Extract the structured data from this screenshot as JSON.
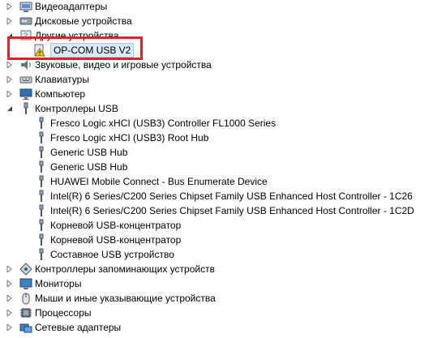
{
  "categories_top": [
    {
      "label": "Видеоадаптеры",
      "icon": "display-adapter-icon",
      "expanded": false
    },
    {
      "label": "Дисковые устройства",
      "icon": "disk-drive-icon",
      "expanded": false
    },
    {
      "label": "Другие устройства",
      "icon": "other-devices-icon",
      "expanded": true
    }
  ],
  "other_device": {
    "label": "OP-COM USB V2",
    "icon": "warning-device-icon"
  },
  "categories_mid": [
    {
      "label": "Звуковые, видео и игровые устройства",
      "icon": "sound-icon",
      "expanded": false
    },
    {
      "label": "Клавиатуры",
      "icon": "keyboard-icon",
      "expanded": false
    },
    {
      "label": "Компьютер",
      "icon": "computer-icon",
      "expanded": false
    },
    {
      "label": "Контроллеры USB",
      "icon": "usb-controller-icon",
      "expanded": true
    }
  ],
  "usb_children": [
    "Fresco Logic xHCI (USB3) Controller FL1000 Series",
    "Fresco Logic xHCI (USB3) Root Hub",
    "Generic USB Hub",
    "Generic USB Hub",
    "HUAWEI Mobile Connect - Bus Enumerate Device",
    "Intel(R) 6 Series/C200 Series Chipset Family USB Enhanced Host Controller - 1C26",
    "Intel(R) 6 Series/C200 Series Chipset Family USB Enhanced Host Controller - 1C2D",
    "Корневой USB-концентратор",
    "Корневой USB-концентратор",
    "Составное USB устройство"
  ],
  "categories_bottom": [
    {
      "label": "Контроллеры запоминающих устройств",
      "icon": "storage-controller-icon",
      "expanded": false
    },
    {
      "label": "Мониторы",
      "icon": "monitor-icon",
      "expanded": false
    },
    {
      "label": "Мыши и иные указывающие устройства",
      "icon": "mouse-icon",
      "expanded": false
    },
    {
      "label": "Процессоры",
      "icon": "processor-icon",
      "expanded": false
    },
    {
      "label": "Сетевые адаптеры",
      "icon": "network-adapter-icon",
      "expanded": false
    }
  ],
  "colors": {
    "highlight": "#e0202b",
    "selection": "#dbe9fb",
    "warning": "#f5c400"
  }
}
